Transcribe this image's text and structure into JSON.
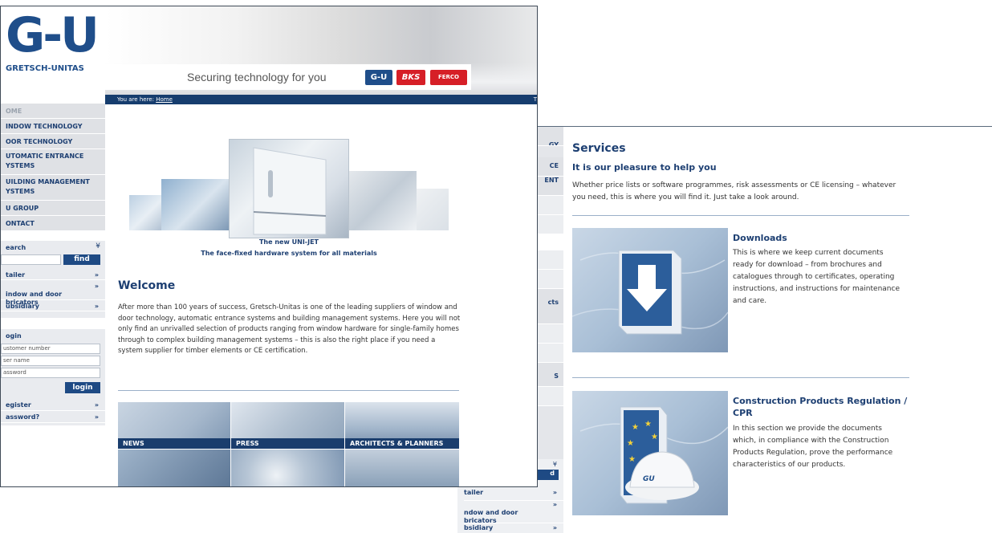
{
  "back_window": {
    "nav_fragments": [
      "GY",
      "CE",
      "ENT",
      "cts",
      "S"
    ],
    "search_arrow": "¥",
    "search_btn": "d",
    "links": [
      {
        "label": "tailer",
        "arrow": "»"
      },
      {
        "label": "ndow and door\nbricators",
        "arrow": "»"
      },
      {
        "label": "bsidiary",
        "arrow": "»"
      }
    ],
    "services": {
      "title": "Services",
      "subtitle": "It is our pleasure to help you",
      "intro": "Whether price lists or software programmes, risk assessments or CE licensing – whatever you need, this is where you will find it. Just take a look around.",
      "items": [
        {
          "heading": "Downloads",
          "text": "This is where we keep current documents ready for download – from brochures and catalogues through to certificates, operating instructions, and instructions for maintenance and care."
        },
        {
          "heading": "Construction Products Regulation / CPR",
          "text": "In this section we provide the documents which, in compliance with the Construction Products Regulation, prove the performance characteristics of our products.",
          "badge": "GU"
        }
      ]
    }
  },
  "front_window": {
    "logo": "G-U",
    "logo_sub": "GRETSCH-UNITAS",
    "slogan": "Securing technology for you",
    "brands": [
      "G-U",
      "BKS",
      "FERCO"
    ],
    "breadcrumb": {
      "prefix": "You are here:",
      "home": "Home",
      "right": "T"
    },
    "nav": [
      "OME",
      "INDOW TECHNOLOGY",
      "OOR TECHNOLOGY",
      "UTOMATIC ENTRANCE\nYSTEMS",
      "UILDING MANAGEMENT\nYSTEMS",
      "U GROUP",
      "ONTACT"
    ],
    "search": {
      "title": "earch",
      "arrow": "¥",
      "button": "find",
      "links": [
        {
          "label": "tailer",
          "arrow": "»"
        },
        {
          "label": "indow and door\nbricators",
          "arrow": "»"
        },
        {
          "label": "ubsidiary",
          "arrow": "»"
        }
      ]
    },
    "login": {
      "title": "ogin",
      "fields": [
        "ustomer number",
        "ser name",
        "assword"
      ],
      "button": "login",
      "links": [
        {
          "label": "egister",
          "arrow": "»"
        },
        {
          "label": "assword?",
          "arrow": "»"
        }
      ]
    },
    "teaser": {
      "line1": "The new UNI-JET",
      "line2": "The face-fixed hardware system for all materials"
    },
    "welcome": {
      "title": "Welcome",
      "text": "After more than 100 years of success, Gretsch-Unitas is one of the leading suppliers of window and door technology, automatic entrance systems and building management systems. Here you will not only find an unrivalled selection of products ranging from window hardware for single-family homes through to complex building management systems – this is also the right place if you need a system supplier for timber elements or CE certification."
    },
    "tiles": [
      "NEWS",
      "PRESS",
      "ARCHITECTS & PLANNERS"
    ]
  },
  "colors": {
    "brand_blue": "#1f4e8a",
    "nav_text": "#1d3f72",
    "bar_blue": "#163d6e",
    "red": "#d61f27"
  }
}
